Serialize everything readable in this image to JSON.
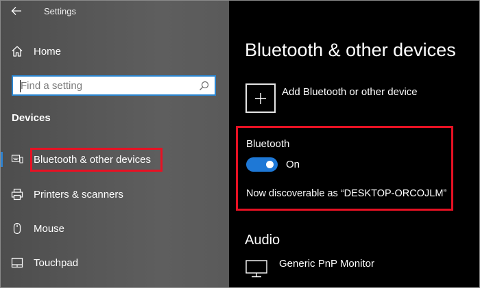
{
  "window": {
    "title": "Settings"
  },
  "sidebar": {
    "home_label": "Home",
    "search": {
      "placeholder": "Find a setting"
    },
    "section_heading": "Devices",
    "items": [
      {
        "label": "Bluetooth & other devices",
        "icon": "bluetooth-devices-icon",
        "selected": true
      },
      {
        "label": "Printers & scanners",
        "icon": "printer-icon",
        "selected": false
      },
      {
        "label": "Mouse",
        "icon": "mouse-icon",
        "selected": false
      },
      {
        "label": "Touchpad",
        "icon": "touchpad-icon",
        "selected": false
      }
    ]
  },
  "main": {
    "title": "Bluetooth & other devices",
    "add_device_label": "Add Bluetooth or other device",
    "bluetooth": {
      "heading": "Bluetooth",
      "toggle_state": "On",
      "toggle_on": true,
      "discoverable_text": "Now discoverable as “DESKTOP-ORCOJLM”"
    },
    "audio": {
      "heading": "Audio",
      "device_label": "Generic PnP Monitor"
    }
  },
  "colors": {
    "accent": "#1e78d6",
    "highlight": "#e81123",
    "sidebar_bg": "#5a5a5a",
    "main_bg": "#000000"
  }
}
